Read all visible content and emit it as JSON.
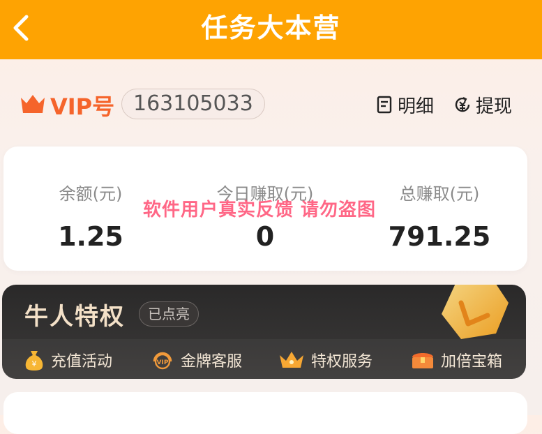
{
  "header": {
    "title": "任务大本营",
    "back_icon": "back-arrow-icon"
  },
  "vip": {
    "label": "VIP号",
    "id": "163105033",
    "crown_icon": "crown-icon"
  },
  "actions": {
    "detail": "明细",
    "withdraw": "提现"
  },
  "stats": [
    {
      "label": "余额(元)",
      "value": "1.25"
    },
    {
      "label": "今日赚取(元)",
      "value": "0"
    },
    {
      "label": "总赚取(元)",
      "value": "791.25"
    }
  ],
  "watermark": "软件用户真实反馈  请勿盗图",
  "privilege": {
    "title": "牛人特权",
    "badge": "已点亮",
    "items": [
      {
        "label": "充值活动",
        "icon": "money-bag-icon"
      },
      {
        "label": "金牌客服",
        "icon": "vip-headset-icon"
      },
      {
        "label": "特权服务",
        "icon": "crown-service-icon"
      },
      {
        "label": "加倍宝箱",
        "icon": "treasure-chest-icon"
      }
    ]
  },
  "colors": {
    "topbar": "#fea302",
    "accent": "#f5642b"
  }
}
